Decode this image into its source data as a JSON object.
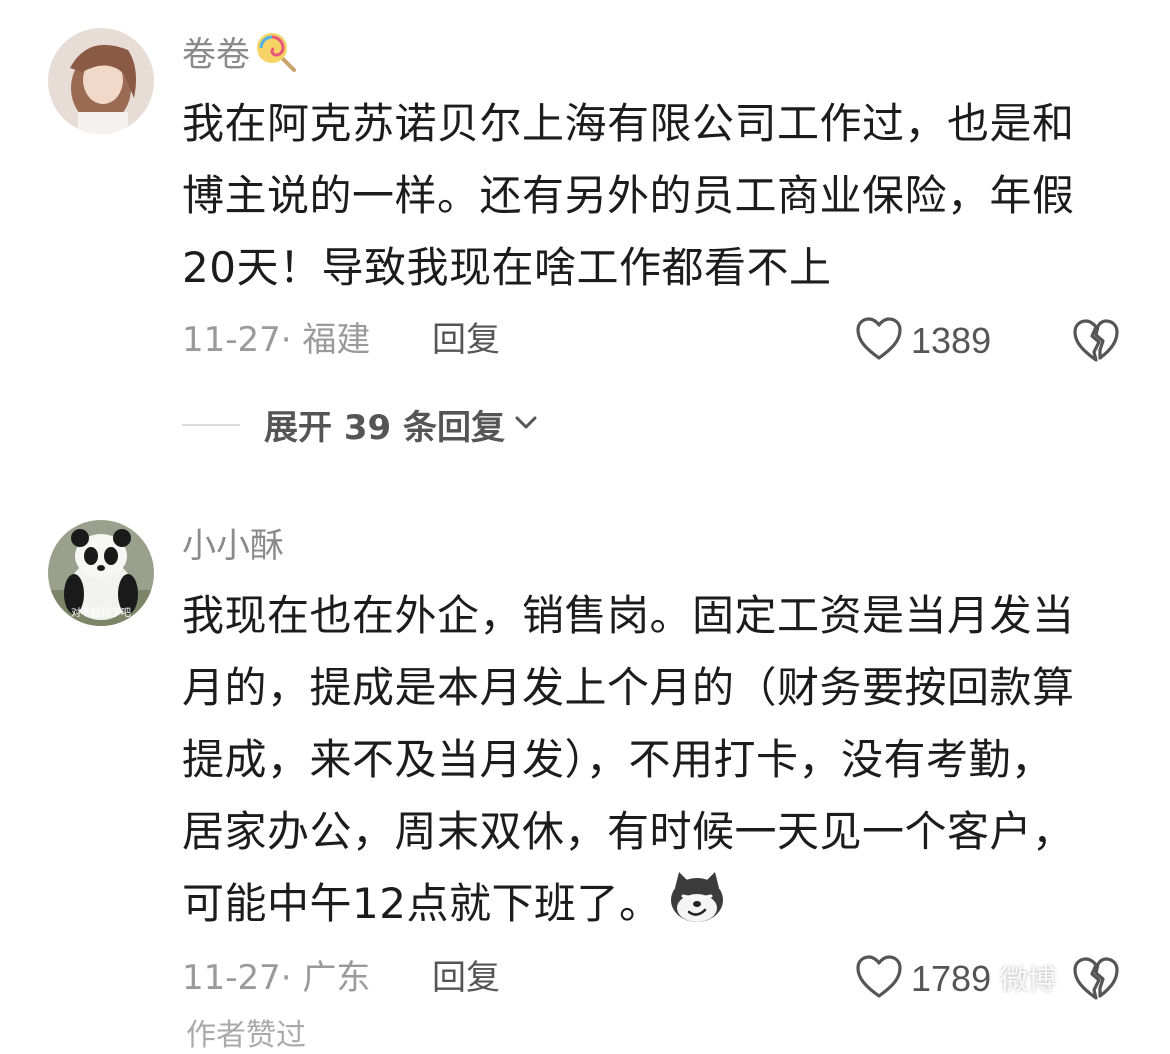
{
  "comments": [
    {
      "username": "卷卷",
      "username_emoji": "lollipop-icon",
      "lines": [
        "我在阿克苏诺贝尔上海有限公司工作过，也是和",
        "博主说的一样。还有另外的员工商业保险，年假",
        "20天！导致我现在啥工作都看不上"
      ],
      "date_location": "11-27· 福建",
      "reply_label": "回复",
      "likes": "1389",
      "expand_label": "展开 39 条回复"
    },
    {
      "username": "小小酥",
      "avatar_caption": "对不起行了吧",
      "lines": [
        "我现在也在外企，销售岗。固定工资是当月发当",
        "月的，提成是本月发上个月的（财务要按回款算",
        "提成，来不及当月发），不用打卡，没有考勤，",
        "居家办公，周末双休，有时候一天见一个客户，",
        "可能中午12点就下班了。"
      ],
      "inline_emoji": "smirk-dog-icon",
      "date_location": "11-27· 广东",
      "reply_label": "回复",
      "likes": "1789"
    }
  ],
  "watermark": "微博",
  "next_partial": "作者赞过"
}
